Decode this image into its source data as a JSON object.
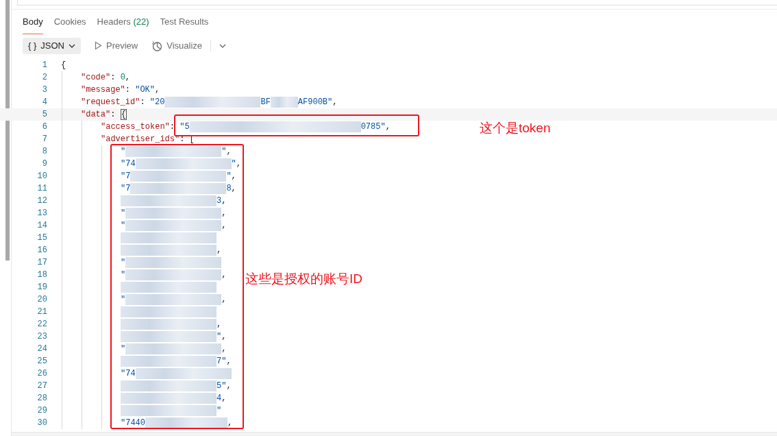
{
  "tabs": [
    {
      "label": "Body",
      "selected": true
    },
    {
      "label": "Cookies",
      "selected": false
    },
    {
      "label": "Headers",
      "count": "(22)",
      "selected": false
    },
    {
      "label": "Test Results",
      "selected": false
    }
  ],
  "toolbar": {
    "format": {
      "icon_text": "{ }",
      "label": "JSON"
    },
    "preview": "Preview",
    "visualize": "Visualize"
  },
  "code_lines": [
    {
      "number": "1",
      "current": false,
      "segments": [
        {
          "kind": "punct",
          "text": "{"
        }
      ],
      "children": [
        {
          "number": "2",
          "current": false,
          "segments": [
            {
              "kind": "key",
              "text": "\"code\""
            },
            {
              "kind": "punct",
              "text": ": "
            },
            {
              "kind": "number",
              "text": "0"
            },
            {
              "kind": "punct",
              "text": ","
            }
          ]
        },
        {
          "number": "3",
          "current": false,
          "segments": [
            {
              "kind": "key",
              "text": "\"message\""
            },
            {
              "kind": "punct",
              "text": ": "
            },
            {
              "kind": "string",
              "text": "\"OK\""
            },
            {
              "kind": "punct",
              "text": ","
            }
          ]
        },
        {
          "number": "4",
          "current": false,
          "segments": [
            {
              "kind": "key",
              "text": "\"request_id\""
            },
            {
              "kind": "punct",
              "text": ": "
            },
            {
              "kind": "string",
              "text": "\"20"
            },
            {
              "kind": "blur"
            },
            {
              "kind": "string",
              "text": "BF"
            },
            {
              "kind": "blur-short"
            },
            {
              "kind": "string",
              "text": "AF900B\""
            },
            {
              "kind": "punct",
              "text": ","
            }
          ]
        },
        {
          "number": "5",
          "current": true,
          "segments": [
            {
              "kind": "key",
              "text": "\"data\""
            },
            {
              "kind": "punct",
              "text": ": "
            },
            {
              "kind": "match",
              "text": "{"
            }
          ],
          "children": [
            {
              "number": "6",
              "current": false,
              "segments": [
                {
                  "kind": "key",
                  "text": "\"access_token\""
                },
                {
                  "kind": "punct",
                  "text": ": "
                },
                {
                  "kind": "string",
                  "text": "\"5"
                },
                {
                  "kind": "blur-long"
                },
                {
                  "kind": "string",
                  "text": "0785\""
                },
                {
                  "kind": "punct",
                  "text": ","
                }
              ]
            },
            {
              "number": "7",
              "current": false,
              "segments": [
                {
                  "kind": "key",
                  "text": "\"advertiser_ids\""
                },
                {
                  "kind": "punct",
                  "text": ": ["
                }
              ],
              "children": [
                {
                  "number": "8",
                  "current": false,
                  "segments": [
                    {
                      "kind": "string",
                      "text": "\""
                    },
                    {
                      "kind": "blur"
                    },
                    {
                      "kind": "string",
                      "text": "\""
                    },
                    {
                      "kind": "punct",
                      "text": ","
                    }
                  ]
                },
                {
                  "number": "9",
                  "current": false,
                  "segments": [
                    {
                      "kind": "string",
                      "text": "\"74"
                    },
                    {
                      "kind": "blur"
                    },
                    {
                      "kind": "string",
                      "text": "\""
                    },
                    {
                      "kind": "punct",
                      "text": ","
                    }
                  ]
                },
                {
                  "number": "10",
                  "current": false,
                  "segments": [
                    {
                      "kind": "string",
                      "text": "\"7"
                    },
                    {
                      "kind": "blur"
                    },
                    {
                      "kind": "string",
                      "text": "\""
                    },
                    {
                      "kind": "punct",
                      "text": ","
                    }
                  ]
                },
                {
                  "number": "11",
                  "current": false,
                  "segments": [
                    {
                      "kind": "string",
                      "text": "\"7"
                    },
                    {
                      "kind": "blur"
                    },
                    {
                      "kind": "string",
                      "text": "8"
                    },
                    {
                      "kind": "punct",
                      "text": ","
                    }
                  ]
                },
                {
                  "number": "12",
                  "current": false,
                  "segments": [
                    {
                      "kind": "blur"
                    },
                    {
                      "kind": "string",
                      "text": "3"
                    },
                    {
                      "kind": "punct",
                      "text": ","
                    }
                  ]
                },
                {
                  "number": "13",
                  "current": false,
                  "segments": [
                    {
                      "kind": "string",
                      "text": "\""
                    },
                    {
                      "kind": "blur"
                    },
                    {
                      "kind": "punct",
                      "text": ","
                    }
                  ]
                },
                {
                  "number": "14",
                  "current": false,
                  "segments": [
                    {
                      "kind": "string",
                      "text": "\""
                    },
                    {
                      "kind": "blur"
                    },
                    {
                      "kind": "punct",
                      "text": ","
                    }
                  ]
                },
                {
                  "number": "15",
                  "current": false,
                  "segments": [
                    {
                      "kind": "blur"
                    }
                  ]
                },
                {
                  "number": "16",
                  "current": false,
                  "segments": [
                    {
                      "kind": "blur"
                    },
                    {
                      "kind": "punct",
                      "text": ","
                    }
                  ]
                },
                {
                  "number": "17",
                  "current": false,
                  "segments": [
                    {
                      "kind": "string",
                      "text": "\""
                    },
                    {
                      "kind": "blur"
                    }
                  ]
                },
                {
                  "number": "18",
                  "current": false,
                  "segments": [
                    {
                      "kind": "string",
                      "text": "\""
                    },
                    {
                      "kind": "blur"
                    },
                    {
                      "kind": "punct",
                      "text": ","
                    }
                  ]
                },
                {
                  "number": "19",
                  "current": false,
                  "segments": [
                    {
                      "kind": "blur"
                    }
                  ]
                },
                {
                  "number": "20",
                  "current": false,
                  "segments": [
                    {
                      "kind": "string",
                      "text": "\""
                    },
                    {
                      "kind": "blur"
                    },
                    {
                      "kind": "punct",
                      "text": ","
                    }
                  ]
                },
                {
                  "number": "21",
                  "current": false,
                  "segments": [
                    {
                      "kind": "blur"
                    }
                  ]
                },
                {
                  "number": "22",
                  "current": false,
                  "segments": [
                    {
                      "kind": "blur"
                    },
                    {
                      "kind": "punct",
                      "text": ","
                    }
                  ]
                },
                {
                  "number": "23",
                  "current": false,
                  "segments": [
                    {
                      "kind": "blur"
                    },
                    {
                      "kind": "string",
                      "text": "\""
                    },
                    {
                      "kind": "punct",
                      "text": ","
                    }
                  ]
                },
                {
                  "number": "24",
                  "current": false,
                  "segments": [
                    {
                      "kind": "string",
                      "text": "\""
                    },
                    {
                      "kind": "blur"
                    },
                    {
                      "kind": "punct",
                      "text": ","
                    }
                  ]
                },
                {
                  "number": "25",
                  "current": false,
                  "segments": [
                    {
                      "kind": "blur"
                    },
                    {
                      "kind": "string",
                      "text": "7\""
                    },
                    {
                      "kind": "punct",
                      "text": ","
                    }
                  ]
                },
                {
                  "number": "26",
                  "current": false,
                  "segments": [
                    {
                      "kind": "string",
                      "text": "\"74"
                    },
                    {
                      "kind": "blur"
                    }
                  ]
                },
                {
                  "number": "27",
                  "current": false,
                  "segments": [
                    {
                      "kind": "blur"
                    },
                    {
                      "kind": "string",
                      "text": "5\""
                    },
                    {
                      "kind": "punct",
                      "text": ","
                    }
                  ]
                },
                {
                  "number": "28",
                  "current": false,
                  "segments": [
                    {
                      "kind": "blur"
                    },
                    {
                      "kind": "string",
                      "text": "4"
                    },
                    {
                      "kind": "punct",
                      "text": ","
                    }
                  ]
                },
                {
                  "number": "29",
                  "current": false,
                  "segments": [
                    {
                      "kind": "blur"
                    },
                    {
                      "kind": "string",
                      "text": "\""
                    }
                  ]
                },
                {
                  "number": "30",
                  "current": false,
                  "segments": [
                    {
                      "kind": "string",
                      "text": "\"7440"
                    },
                    {
                      "kind": "blur-mid"
                    },
                    {
                      "kind": "punct",
                      "text": ","
                    }
                  ]
                }
              ]
            }
          ]
        }
      ]
    }
  ],
  "annotations": [
    {
      "kind": "token",
      "text": "这个是token"
    },
    {
      "kind": "ids",
      "text": "这些是授权的账号ID"
    }
  ]
}
